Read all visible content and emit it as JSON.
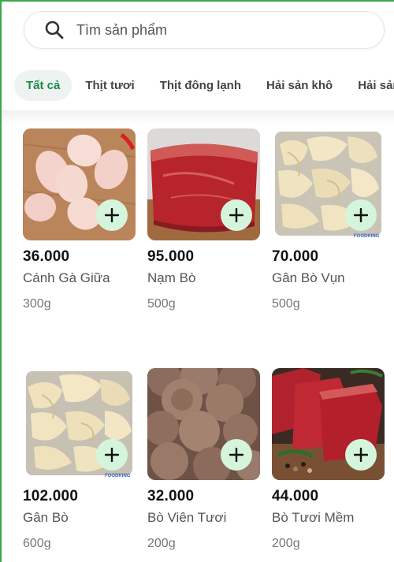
{
  "search": {
    "placeholder": "Tìm sản phẩm"
  },
  "tabs": [
    {
      "label": "Tất cả",
      "active": true
    },
    {
      "label": "Thịt tươi",
      "active": false
    },
    {
      "label": "Thịt đông lạnh",
      "active": false
    },
    {
      "label": "Hải sản khô",
      "active": false
    },
    {
      "label": "Hải sản",
      "active": false
    }
  ],
  "products": [
    {
      "price": "36.000",
      "name": "Cánh Gà Giữa",
      "weight": "300g",
      "image": "chicken-wings"
    },
    {
      "price": "95.000",
      "name": "Nạm Bò",
      "weight": "500g",
      "image": "beef-flank"
    },
    {
      "price": "70.000",
      "name": "Gân Bò Vụn",
      "weight": "500g",
      "image": "beef-tendon-pieces",
      "watermark": "FOODKING"
    },
    {
      "price": "102.000",
      "name": "Gân Bò",
      "weight": "600g",
      "image": "beef-tendon",
      "watermark": "FOODKING"
    },
    {
      "price": "32.000",
      "name": "Bò Viên Tươi",
      "weight": "200g",
      "image": "beef-balls"
    },
    {
      "price": "44.000",
      "name": "Bò Tươi Mềm",
      "weight": "200g",
      "image": "fresh-beef"
    }
  ],
  "colors": {
    "accent": "#1a8a4a",
    "add_bg": "#d4f5dc",
    "frame": "#3aa84a"
  }
}
